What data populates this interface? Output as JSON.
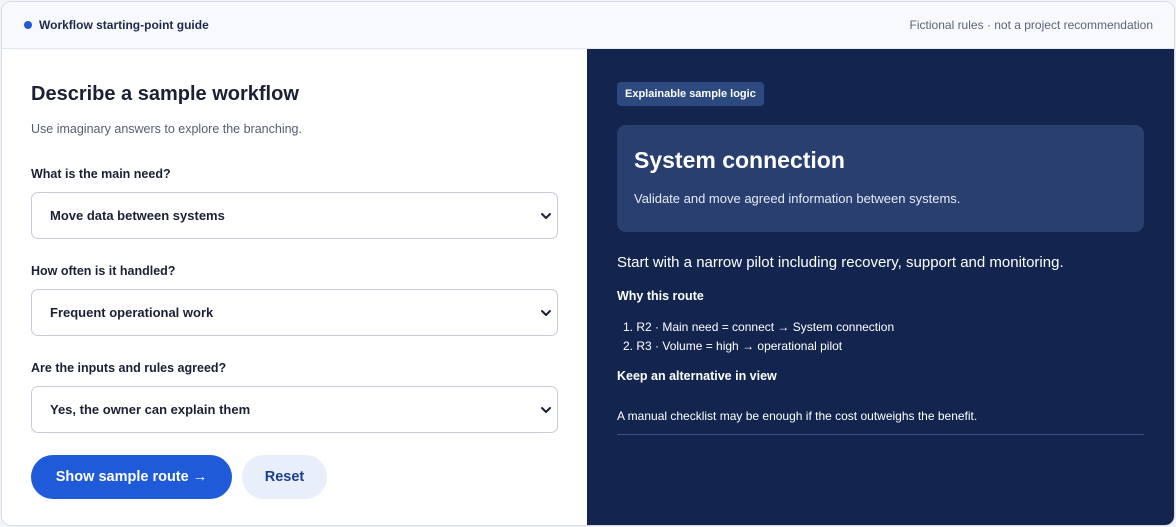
{
  "header": {
    "brand": "Workflow starting-point guide",
    "note": "Fictional rules · not a project recommendation",
    "accent": "#1f5bd8"
  },
  "form": {
    "title": "Describe a sample workflow",
    "subtitle": "Use imaginary answers to explore the branching.",
    "questions": [
      {
        "label": "What is the main need?",
        "value": "Move data between systems"
      },
      {
        "label": "How often is it handled?",
        "value": "Frequent operational work"
      },
      {
        "label": "Are the inputs and rules agreed?",
        "value": "Yes, the owner can explain them"
      }
    ],
    "primary_button": "Show sample route →",
    "secondary_button": "Reset"
  },
  "result": {
    "badge": "Explainable sample logic",
    "card_title": "System connection",
    "card_text": "Validate and move agreed information between systems.",
    "lead": "Start with a narrow pilot including recovery, support and monitoring.",
    "why_heading": "Why this route",
    "reasons": [
      "1. R2 · Main need = connect → System connection",
      "2. R3 · Volume = high → operational pilot"
    ],
    "alt_heading": "Keep an alternative in view",
    "alt_text": "A manual checklist may be enough if the cost outweighs the benefit.",
    "panel_color": "#13254f"
  },
  "icons": {
    "select": "chevron-down-icon"
  }
}
